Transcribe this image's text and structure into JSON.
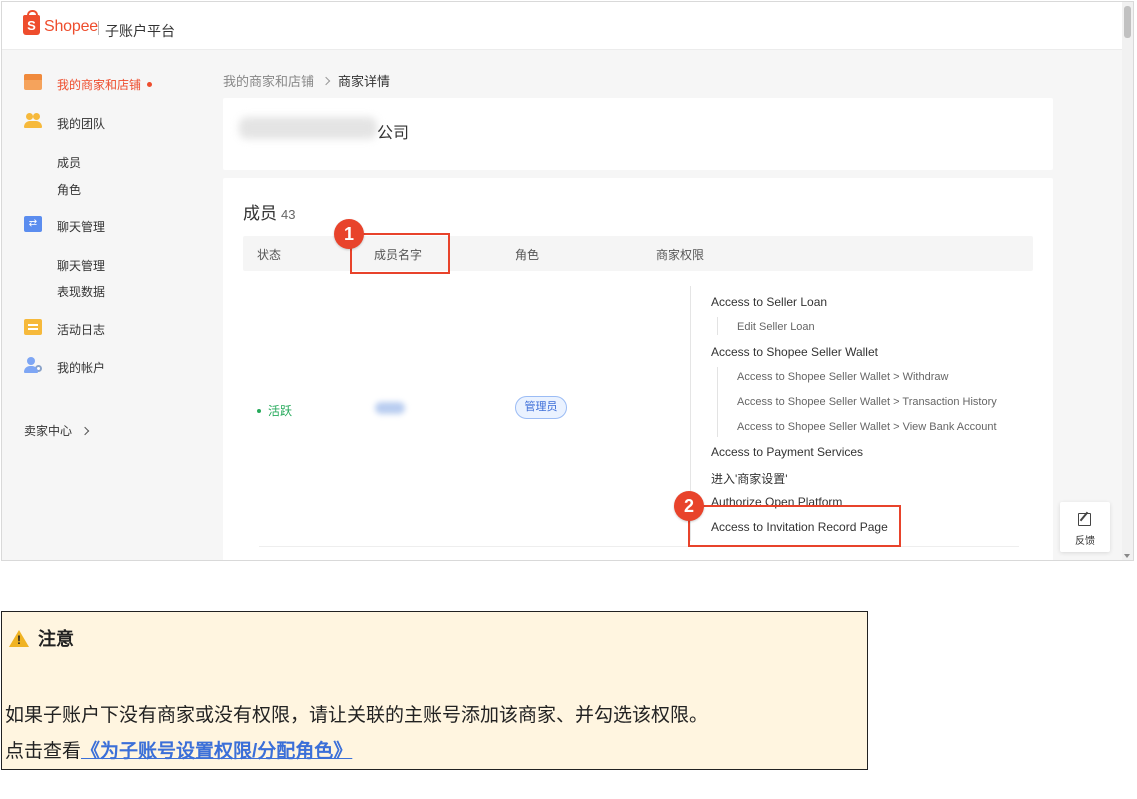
{
  "header": {
    "brand": "Shopee",
    "subtitle": "子账户平台",
    "logo_letter": "S"
  },
  "sidebar": {
    "items": [
      {
        "label": "我的商家和店铺",
        "icon": "store-icon"
      },
      {
        "label": "我的团队",
        "icon": "team-icon"
      },
      {
        "label": "成员"
      },
      {
        "label": "角色"
      },
      {
        "label": "聊天管理",
        "icon": "chat-icon"
      },
      {
        "label": "聊天管理"
      },
      {
        "label": "表现数据"
      },
      {
        "label": "活动日志",
        "icon": "log-icon"
      },
      {
        "label": "我的帐户",
        "icon": "account-icon"
      }
    ],
    "seller_center": "卖家中心"
  },
  "breadcrumb": {
    "parent": "我的商家和店铺",
    "current": "商家详情"
  },
  "company": {
    "name_suffix": "公司"
  },
  "members": {
    "title": "成员",
    "count": "43",
    "columns": [
      "状态",
      "成员名字",
      "角色",
      "商家权限"
    ],
    "row": {
      "status": "活跃",
      "role": "管理员"
    },
    "permissions": [
      "Access to Seller Loan",
      "Edit Seller Loan",
      "Access to Shopee Seller Wallet",
      "Access to Shopee Seller Wallet > Withdraw",
      "Access to Shopee Seller Wallet > Transaction History",
      "Access to Shopee Seller Wallet > View Bank Account",
      "Access to Payment Services",
      "进入'商家设置'",
      "Authorize Open Platform",
      "Access to Invitation Record Page"
    ]
  },
  "annotations": {
    "marker1": "1",
    "marker2": "2",
    "highlight_color": "#e8432b"
  },
  "feedback": {
    "label": "反馈"
  },
  "note": {
    "title": "注意",
    "line1": "如果子账户下没有商家或没有权限，请让关联的主账号添加该商家、并勾选该权限。",
    "line2_prefix": "点击查看",
    "line2_link": "《为子账号设置权限/分配角色》"
  },
  "colors": {
    "brand": "#ee4d2d",
    "status_active": "#26aa5b",
    "link": "#3b6fd8",
    "note_bg": "#fff5e0"
  }
}
